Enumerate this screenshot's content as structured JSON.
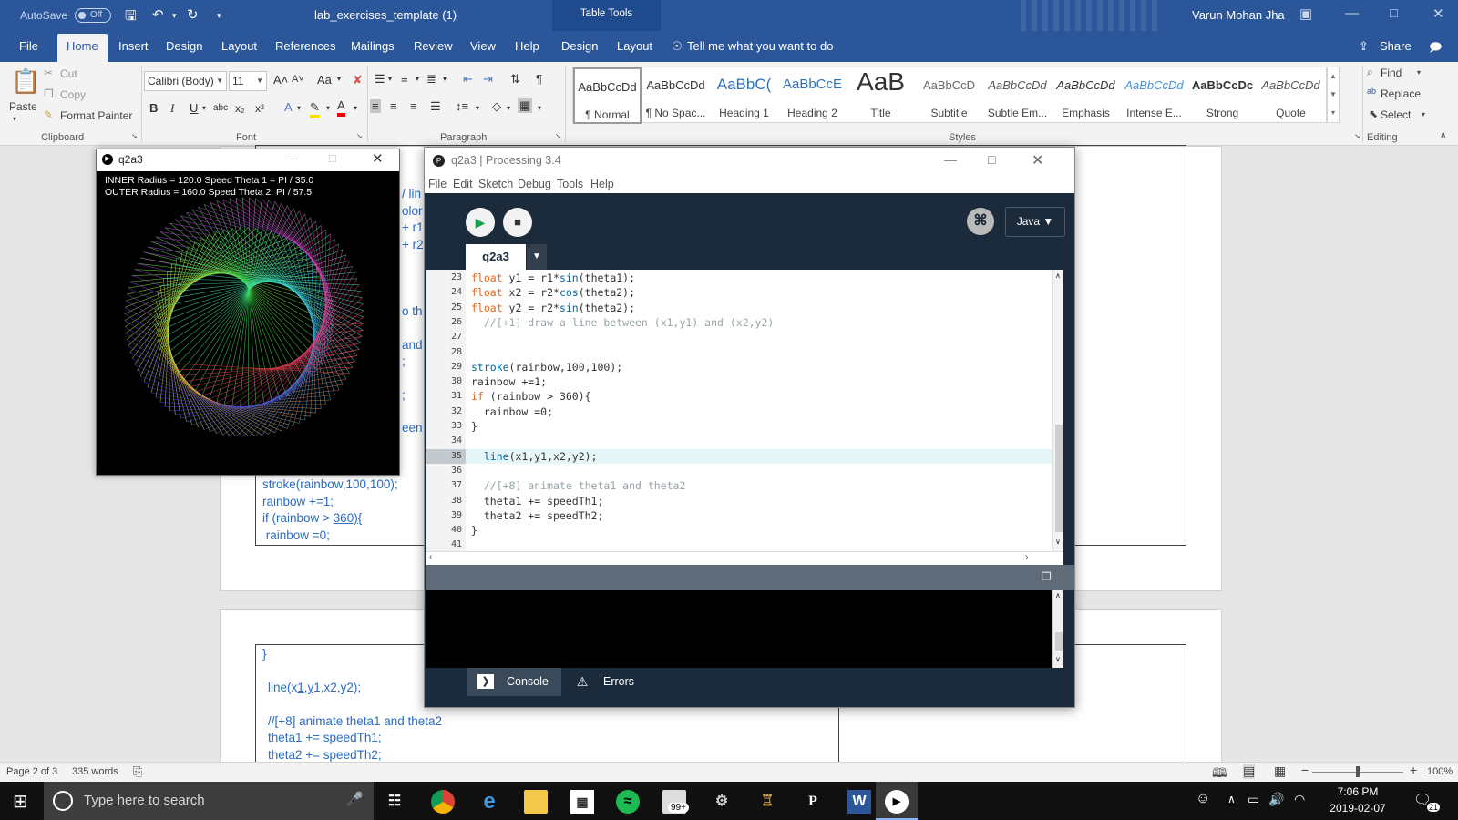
{
  "word": {
    "titlebar": {
      "autosave_label": "AutoSave",
      "autosave_state": "Off",
      "save_icon": "save-icon",
      "undo_icon": "undo-icon",
      "redo_icon": "redo-icon",
      "doc_title": "lab_exercises_template (1)",
      "contextual_group": "Table Tools",
      "user_name": "Varun Mohan Jha",
      "brand_color": "#2b579a"
    },
    "tabs": [
      "File",
      "Home",
      "Insert",
      "Design",
      "Layout",
      "References",
      "Mailings",
      "Review",
      "View",
      "Help",
      "Design",
      "Layout"
    ],
    "active_tab": "Home",
    "tell_me": "Tell me what you want to do",
    "share_label": "Share",
    "clipboard": {
      "paste": "Paste",
      "cut": "Cut",
      "copy": "Copy",
      "format_painter": "Format Painter",
      "group": "Clipboard"
    },
    "font": {
      "name": "Calibri (Body)",
      "size": "11",
      "group": "Font",
      "case_label": "Aa",
      "bold": "B",
      "italic": "I",
      "underline": "U",
      "strike": "abc",
      "subscript": "x₂",
      "superscript": "x²"
    },
    "paragraph": {
      "group": "Paragraph"
    },
    "styles": {
      "group": "Styles",
      "items": [
        {
          "preview": "AaBbCcDd",
          "name": "¶ Normal"
        },
        {
          "preview": "AaBbCcDd",
          "name": "¶ No Spac..."
        },
        {
          "preview": "AaBbC(",
          "name": "Heading 1"
        },
        {
          "preview": "AaBbCcE",
          "name": "Heading 2"
        },
        {
          "preview": "AaB",
          "name": "Title"
        },
        {
          "preview": "AaBbCcD",
          "name": "Subtitle"
        },
        {
          "preview": "AaBbCcDd",
          "name": "Subtle Em..."
        },
        {
          "preview": "AaBbCcDd",
          "name": "Emphasis"
        },
        {
          "preview": "AaBbCcDd",
          "name": "Intense E..."
        },
        {
          "preview": "AaBbCcDc",
          "name": "Strong"
        },
        {
          "preview": "AaBbCcDd",
          "name": "Quote"
        }
      ]
    },
    "editing": {
      "find": "Find",
      "replace": "Replace",
      "select": "Select",
      "group": "Editing"
    },
    "document": {
      "peek_fragments": [
        "/ lin",
        "olor",
        "+ r1",
        "+ r2",
        "o th",
        "and",
        ";",
        ";",
        "een"
      ],
      "page1_lines": [
        "stroke(rainbow,100,100);",
        "rainbow +=1;",
        "if (rainbow > ",
        "360){",
        " rainbow =0;"
      ],
      "page2_lines": [
        "}",
        "line(x",
        "1",
        ",",
        "y",
        "1,x2,y2);",
        "//",
        "[",
        "+8] animate theta1 and theta2",
        "theta1 += speedTh1;",
        "theta2 += speedTh2;"
      ],
      "text_color": "#2b6cc4"
    },
    "statusbar": {
      "page": "Page 2 of 3",
      "words": "335 words",
      "zoom": "100%"
    }
  },
  "sketch_window": {
    "title": "q2a3",
    "readout_line1": "INNER Radius = 120.0  Speed Theta 1 =  PI / 35.0",
    "readout_line2": "OUTER Radius = 160.0  Speed Theta 2:  PI / 57.5",
    "inner_radius": 120.0,
    "outer_radius": 160.0,
    "speed_theta1_divisor": 35.0,
    "speed_theta2_divisor": 57.5
  },
  "ide": {
    "title": "q2a3 | Processing 3.4",
    "menu": [
      "File",
      "Edit",
      "Sketch",
      "Debug",
      "Tools",
      "Help"
    ],
    "mode": "Java",
    "tab": "q2a3",
    "highlighted_line": 35,
    "code_lines": [
      {
        "n": "23",
        "tokens": [
          [
            "kw",
            "float"
          ],
          [
            "t",
            " y1 = r1*"
          ],
          [
            "fn",
            "sin"
          ],
          [
            "t",
            "(theta1);"
          ]
        ]
      },
      {
        "n": "24",
        "tokens": [
          [
            "kw",
            "float"
          ],
          [
            "t",
            " x2 = r2*"
          ],
          [
            "fn",
            "cos"
          ],
          [
            "t",
            "(theta2);"
          ]
        ]
      },
      {
        "n": "25",
        "tokens": [
          [
            "kw",
            "float"
          ],
          [
            "t",
            " y2 = r2*"
          ],
          [
            "fn",
            "sin"
          ],
          [
            "t",
            "(theta2);"
          ]
        ]
      },
      {
        "n": "26",
        "tokens": [
          [
            "cm",
            "  //[+1] draw a line between (x1,y1) and (x2,y2)"
          ]
        ]
      },
      {
        "n": "27",
        "tokens": []
      },
      {
        "n": "28",
        "tokens": []
      },
      {
        "n": "29",
        "tokens": [
          [
            "fn",
            "stroke"
          ],
          [
            "t",
            "(rainbow,100,100);"
          ]
        ]
      },
      {
        "n": "30",
        "tokens": [
          [
            "t",
            "rainbow +=1;"
          ]
        ]
      },
      {
        "n": "31",
        "tokens": [
          [
            "kw",
            "if"
          ],
          [
            "t",
            " (rainbow > 360){"
          ]
        ]
      },
      {
        "n": "32",
        "tokens": [
          [
            "t",
            "  rainbow =0;"
          ]
        ]
      },
      {
        "n": "33",
        "tokens": [
          [
            "t",
            "}"
          ]
        ]
      },
      {
        "n": "34",
        "tokens": []
      },
      {
        "n": "35",
        "tokens": [
          [
            "t",
            "  "
          ],
          [
            "fn",
            "line"
          ],
          [
            "t",
            "(x1,y1,x2,y2);"
          ]
        ]
      },
      {
        "n": "36",
        "tokens": []
      },
      {
        "n": "37",
        "tokens": [
          [
            "cm",
            "  //[+8] animate theta1 and theta2"
          ]
        ]
      },
      {
        "n": "38",
        "tokens": [
          [
            "t",
            "  theta1 += speedTh1;"
          ]
        ]
      },
      {
        "n": "39",
        "tokens": [
          [
            "t",
            "  theta2 += speedTh2;"
          ]
        ]
      },
      {
        "n": "40",
        "tokens": [
          [
            "t",
            "}"
          ]
        ]
      },
      {
        "n": "41",
        "tokens": []
      }
    ],
    "console_tab": "Console",
    "errors_tab": "Errors",
    "colors": {
      "keyword": "#e2661a",
      "function": "#006699",
      "comment": "#95a5a6",
      "frame": "#1b2b3c"
    }
  },
  "taskbar": {
    "search_placeholder": "Type here to search",
    "badge": "99+",
    "time": "7:06 PM",
    "date": "2019-02-07",
    "notification_count": "21",
    "apps": [
      "task-view-icon",
      "chrome-icon",
      "edge-icon",
      "file-explorer-icon",
      "store-icon",
      "spotify-icon",
      "mail-icon",
      "settings-icon",
      "league-icon",
      "processing-icon",
      "word-icon",
      "media-icon"
    ]
  }
}
